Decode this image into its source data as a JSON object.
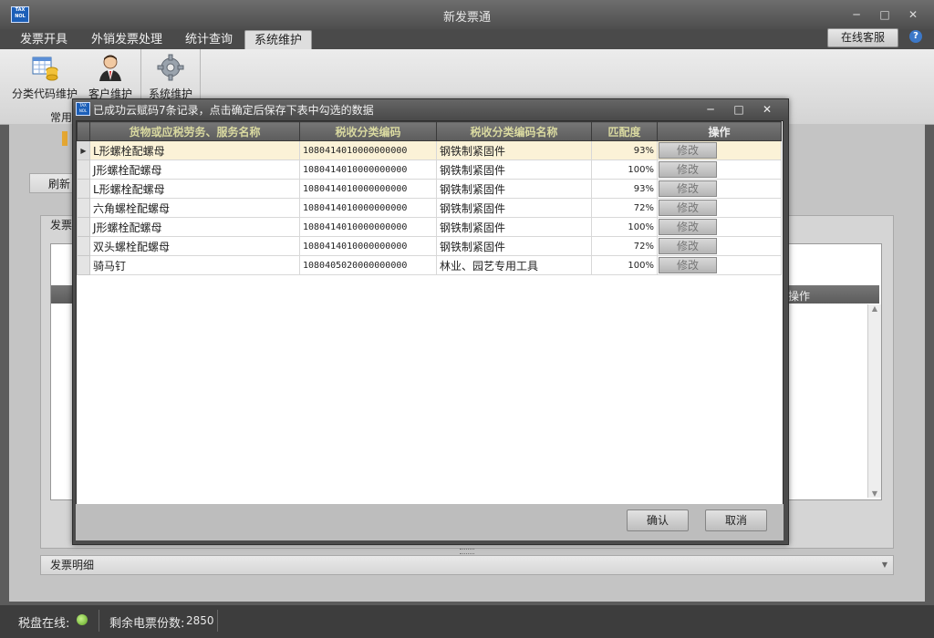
{
  "app": {
    "title": "新发票通",
    "logo_text": "TAX NOL"
  },
  "tabs": [
    "发票开具",
    "外销发票处理",
    "统计查询",
    "系统维护"
  ],
  "online_service_label": "在线客服",
  "ribbon": {
    "items": [
      {
        "label": "分类代码维护",
        "icon": "table-database-icon"
      },
      {
        "label": "客户维护",
        "icon": "business-person-icon"
      },
      {
        "label": "系统维护",
        "icon": "gear-icon"
      }
    ],
    "group_label": "常用"
  },
  "background": {
    "refresh_label": "刷新",
    "panel_title": "发票",
    "column_operation": "操作",
    "invoice_detail_label": "发票明细"
  },
  "dialog": {
    "title": "已成功云赋码7条记录，点击确定后保存下表中勾选的数据",
    "columns": [
      "货物或应税劳务、服务名称",
      "税收分类编码",
      "税收分类编码名称",
      "匹配度",
      "操作"
    ],
    "rows": [
      {
        "name": "L形螺栓配螺母",
        "code": "1080414010000000000",
        "category": "钢铁制紧固件",
        "match": "93%",
        "action": "修改"
      },
      {
        "name": "J形螺栓配螺母",
        "code": "1080414010000000000",
        "category": "钢铁制紧固件",
        "match": "100%",
        "action": "修改"
      },
      {
        "name": "L形螺栓配螺母",
        "code": "1080414010000000000",
        "category": "钢铁制紧固件",
        "match": "93%",
        "action": "修改"
      },
      {
        "name": "六角螺栓配螺母",
        "code": "1080414010000000000",
        "category": "钢铁制紧固件",
        "match": "72%",
        "action": "修改"
      },
      {
        "name": "J形螺栓配螺母",
        "code": "1080414010000000000",
        "category": "钢铁制紧固件",
        "match": "100%",
        "action": "修改"
      },
      {
        "name": "双头螺栓配螺母",
        "code": "1080414010000000000",
        "category": "钢铁制紧固件",
        "match": "72%",
        "action": "修改"
      },
      {
        "name": "骑马钉",
        "code": "1080405020000000000",
        "category": "林业、园艺专用工具",
        "match": "100%",
        "action": "修改"
      }
    ],
    "confirm_label": "确认",
    "cancel_label": "取消"
  },
  "status": {
    "disk_online_label": "税盘在线:",
    "remaining_label": "剩余电票份数:",
    "remaining_count": "2850"
  }
}
